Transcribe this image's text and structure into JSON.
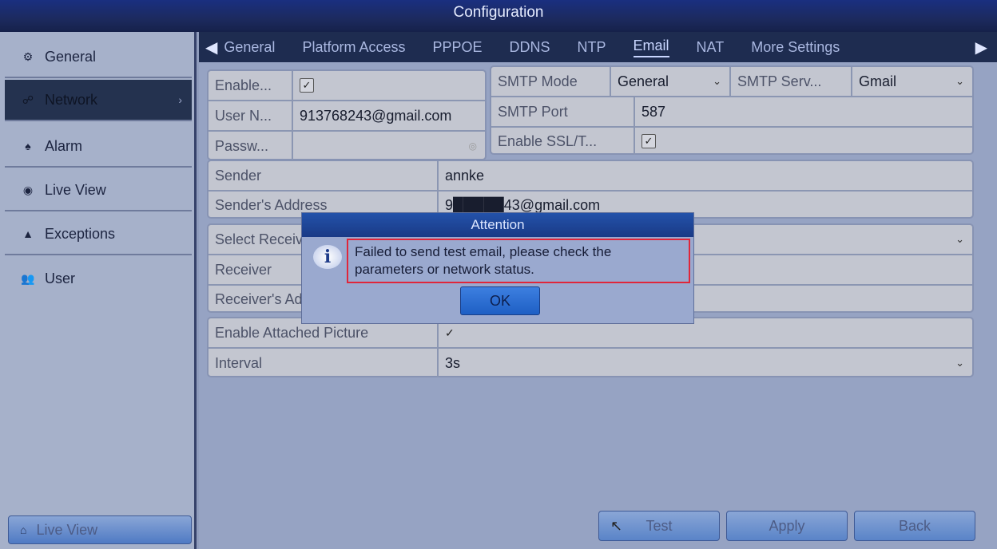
{
  "window": {
    "title": "Configuration"
  },
  "sidebar": {
    "items": [
      {
        "label": "General",
        "icon": "gear-icon",
        "glyph": "⚙"
      },
      {
        "label": "Network",
        "icon": "network-icon",
        "glyph": "☍",
        "active": true,
        "chevron": "›"
      },
      {
        "label": "Alarm",
        "icon": "alarm-icon",
        "glyph": "♠"
      },
      {
        "label": "Live View",
        "icon": "eye-icon",
        "glyph": "◉"
      },
      {
        "label": "Exceptions",
        "icon": "warning-icon",
        "glyph": "▲"
      },
      {
        "label": "User",
        "icon": "users-icon",
        "glyph": "👥"
      }
    ],
    "live_view_button": {
      "label": "Live View",
      "glyph": "⌂"
    }
  },
  "tabs": {
    "left_arrow": "◀",
    "right_arrow": "▶",
    "items": [
      "General",
      "Platform Access",
      "PPPOE",
      "DDNS",
      "NTP",
      "Email",
      "NAT",
      "More Settings"
    ],
    "active": "Email"
  },
  "form": {
    "enable_label": "Enable...",
    "enable_checked": "✓",
    "username_label": "User N...",
    "username_value": "913768243@gmail.com",
    "password_label": "Passw...",
    "password_value": "",
    "password_eye": "◎",
    "smtp_mode_label": "SMTP Mode",
    "smtp_mode_value": "General",
    "smtp_server_label": "SMTP Serv...",
    "smtp_server_value": "Gmail",
    "smtp_port_label": "SMTP Port",
    "smtp_port_value": "587",
    "ssl_label": "Enable SSL/T...",
    "ssl_checked": "✓",
    "sender_label": "Sender",
    "sender_value": "annke",
    "sender_address_label": "Sender's Address",
    "sender_address_value": "9█████43@gmail.com",
    "select_receiver_label": "Select Receiver",
    "receiver_label": "Receiver",
    "receiver_address_label": "Receiver's Address",
    "attached_picture_label": "Enable Attached Picture",
    "attached_picture_checked": "✓",
    "interval_label": "Interval",
    "interval_value": "3s",
    "dropdown_glyph": "⌄"
  },
  "buttons": {
    "test": "Test",
    "apply": "Apply",
    "back": "Back",
    "cursor": "↖"
  },
  "dialog": {
    "title": "Attention",
    "icon_glyph": "i",
    "message": "Failed to send test email, please check the parameters or network status.",
    "ok": "OK"
  }
}
